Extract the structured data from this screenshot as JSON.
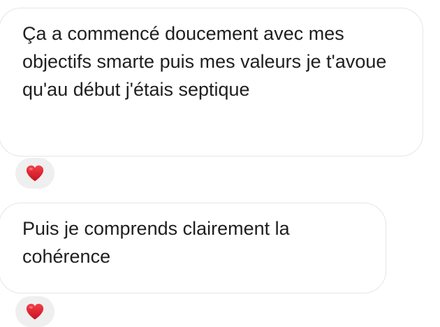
{
  "messages": [
    {
      "text": "Ça a commencé doucement avec mes objectifs smarte puis mes valeurs je t'avoue qu'au début j'étais septique",
      "reaction": "heart-icon"
    },
    {
      "text": "Puis je comprends clairement la cohérence",
      "reaction": "heart-icon"
    }
  ],
  "colors": {
    "bubble_border": "#e6e6e6",
    "reaction_bg": "#efefef",
    "heart": "#e0202f",
    "text": "#1f1f1f"
  }
}
